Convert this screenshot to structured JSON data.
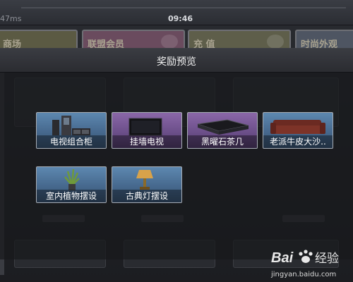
{
  "status_bar": {
    "ping": "47ms",
    "time": "09:46"
  },
  "background_tabs": [
    {
      "label": "商场"
    },
    {
      "label": "联盟会员"
    },
    {
      "label": "充 值"
    },
    {
      "label": "时尚外观"
    }
  ],
  "modal": {
    "title": "奖励预览",
    "rewards": [
      {
        "label": "电视组合柜",
        "rarity": "blue",
        "icon": "tv-cabinet-icon"
      },
      {
        "label": "挂墙电视",
        "rarity": "purple",
        "icon": "wall-tv-icon"
      },
      {
        "label": "黑曜石茶几",
        "rarity": "purple",
        "icon": "coffee-table-icon"
      },
      {
        "label": "老派牛皮大沙..",
        "rarity": "blue",
        "icon": "sofa-icon"
      },
      {
        "label": "室内植物摆设",
        "rarity": "blue",
        "icon": "plant-icon"
      },
      {
        "label": "古典灯摆设",
        "rarity": "blue",
        "icon": "lamp-icon"
      }
    ]
  },
  "watermark": {
    "logo_text": "Bai 经验",
    "url": "jingyan.baidu.com"
  },
  "colors": {
    "rarity_blue": "#46688d",
    "rarity_purple": "#6c4f8a",
    "modal_header": "#2b2c31"
  }
}
